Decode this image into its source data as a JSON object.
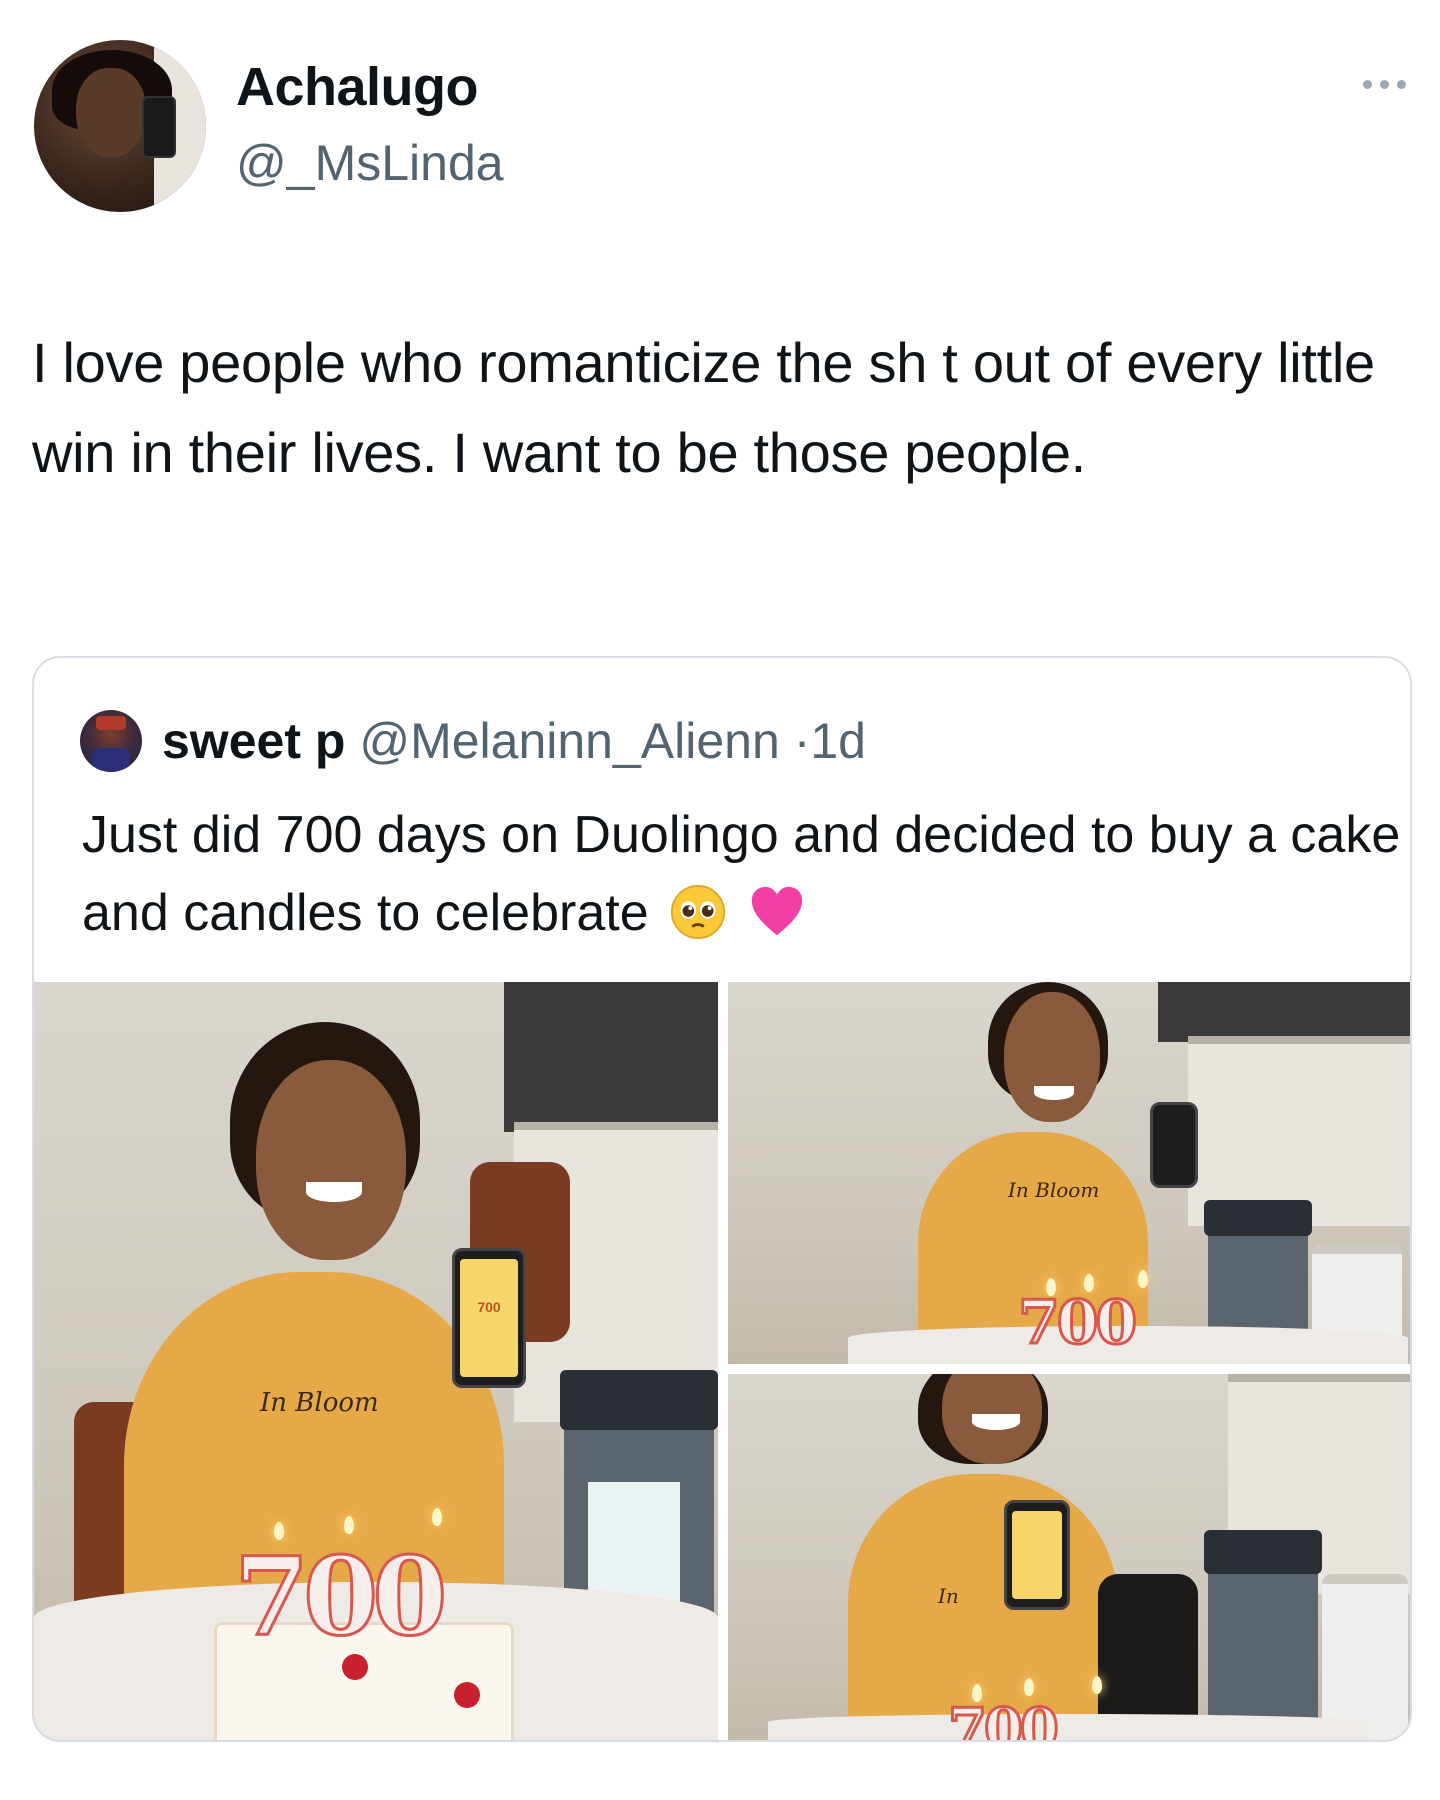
{
  "tweet": {
    "author_name": "Achalugo",
    "author_handle": "@_MsLinda",
    "text": "I love people who romanticize the sh t out of every little win in their lives. I want to be those people.",
    "more_icon": "more-horizontal-icon"
  },
  "quoted_tweet": {
    "author_name": "sweet p",
    "author_handle": "@Melaninn_Alienn",
    "separator": "·",
    "time": "1d",
    "text": "Just did 700 days on Duolingo and decided to buy a cake and candles to celebrate",
    "emojis": [
      "pleading-face-emoji",
      "pink-heart-emoji"
    ],
    "photos": {
      "photo1": {
        "shirt_text": "In Bloom",
        "phone_screen_text": "700",
        "candles": "700"
      },
      "photo2": {
        "shirt_text": "In Bloom",
        "candles": "700"
      },
      "photo3": {
        "shirt_text": "In",
        "candles": "700"
      }
    }
  },
  "colors": {
    "text_primary": "#0f1419",
    "text_secondary": "#536471",
    "border": "#d7dde2"
  }
}
